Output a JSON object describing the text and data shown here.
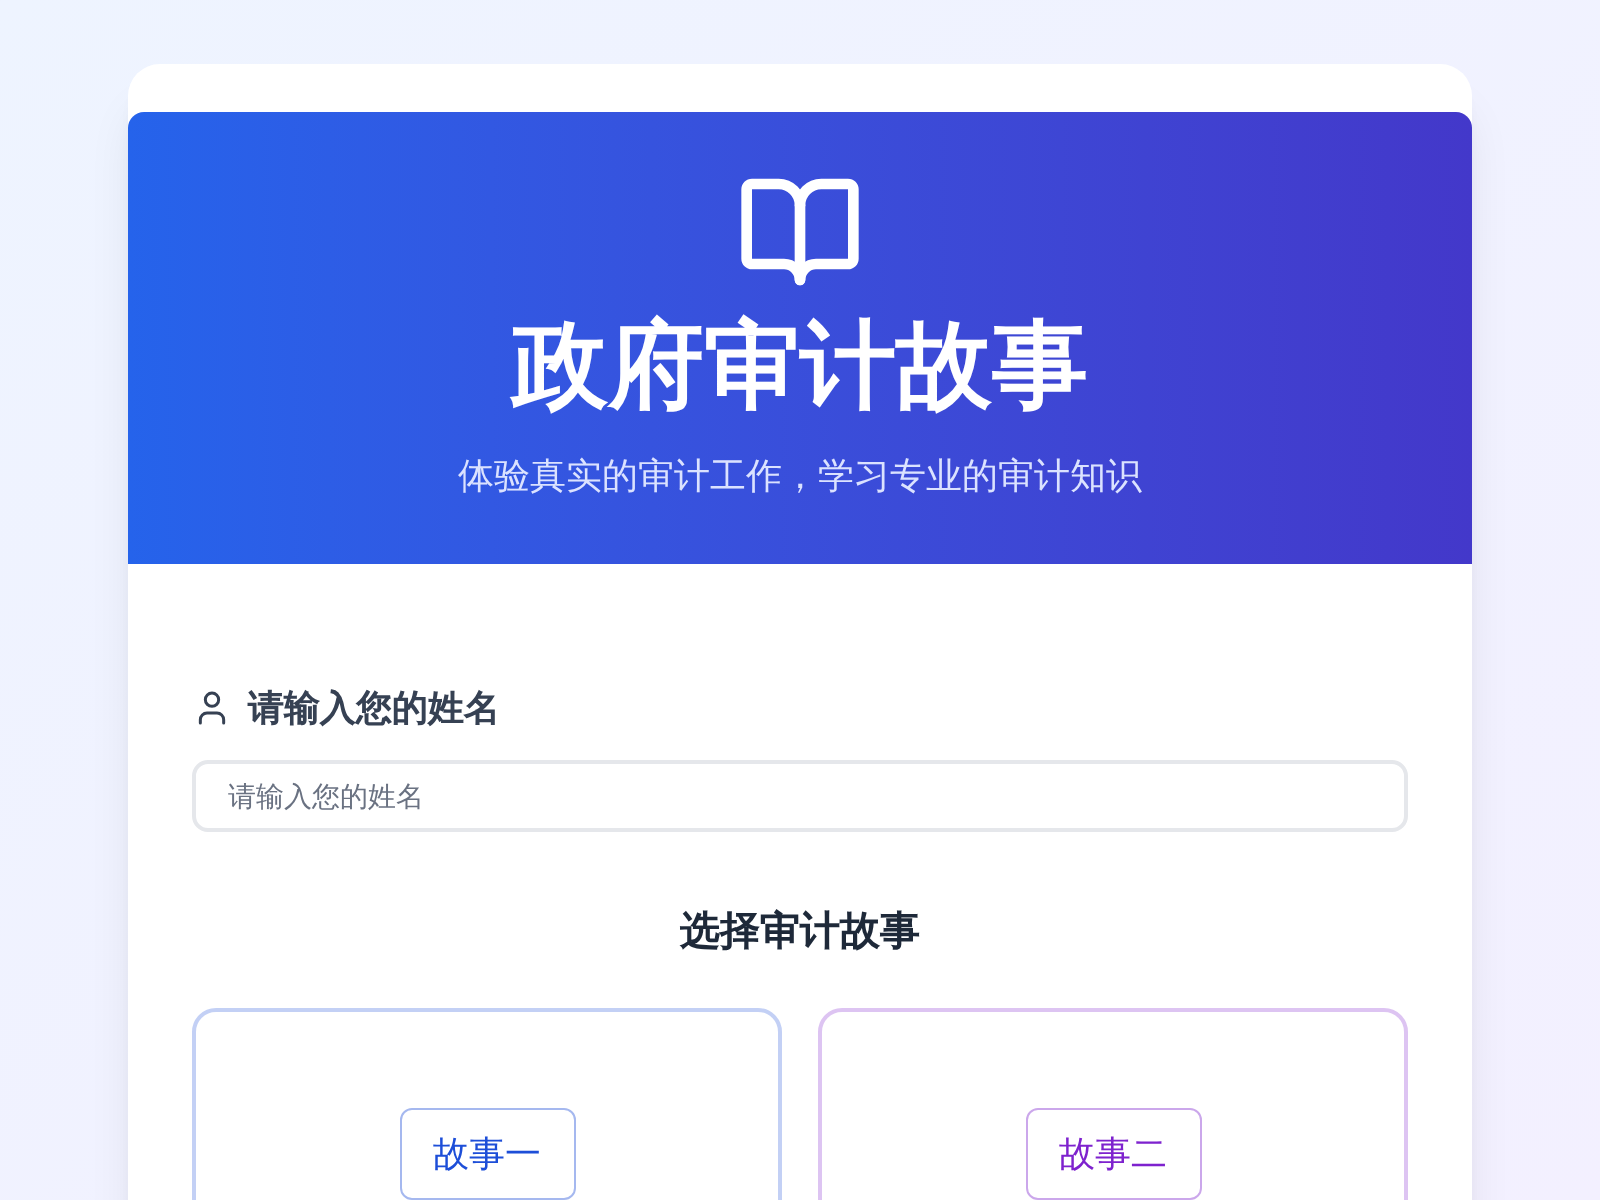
{
  "header": {
    "title": "政府审计故事",
    "subtitle": "体验真实的审计工作，学习专业的审计知识"
  },
  "name_field": {
    "label": "请输入您的姓名",
    "placeholder": "请输入您的姓名"
  },
  "stories_heading": "选择审计故事",
  "stories": [
    {
      "label": "故事一",
      "color": "#1d4ed8"
    },
    {
      "label": "故事二",
      "color": "#7e22ce"
    }
  ]
}
